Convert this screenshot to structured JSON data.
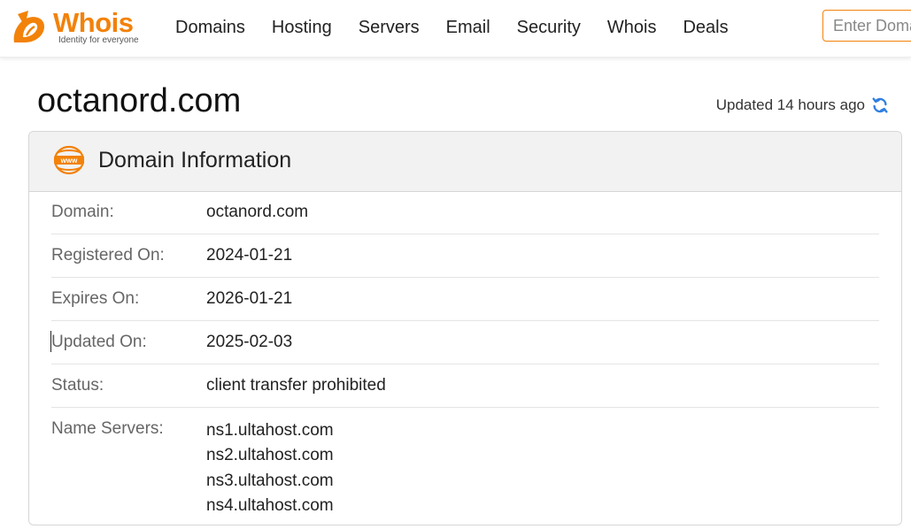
{
  "brand": {
    "name": "Whois",
    "tagline": "Identity for everyone",
    "accent": "#f2820a"
  },
  "nav": {
    "items": [
      {
        "label": "Domains"
      },
      {
        "label": "Hosting"
      },
      {
        "label": "Servers"
      },
      {
        "label": "Email"
      },
      {
        "label": "Security"
      },
      {
        "label": "Whois"
      },
      {
        "label": "Deals"
      }
    ],
    "search_placeholder": "Enter Domain"
  },
  "page": {
    "title": "octanord.com",
    "updated": "Updated 14 hours ago",
    "refresh_icon": "refresh-icon"
  },
  "card": {
    "icon": "www-icon",
    "title": "Domain Information",
    "rows": [
      {
        "label": "Domain:",
        "value": "octanord.com"
      },
      {
        "label": "Registered On:",
        "value": "2024-01-21"
      },
      {
        "label": "Expires On:",
        "value": "2026-01-21"
      },
      {
        "label": "Updated On:",
        "value": "2025-02-03"
      },
      {
        "label": "Status:",
        "value": "client transfer prohibited"
      }
    ],
    "name_servers_label": "Name Servers:",
    "name_servers": [
      "ns1.ultahost.com",
      "ns2.ultahost.com",
      "ns3.ultahost.com",
      "ns4.ultahost.com"
    ]
  }
}
